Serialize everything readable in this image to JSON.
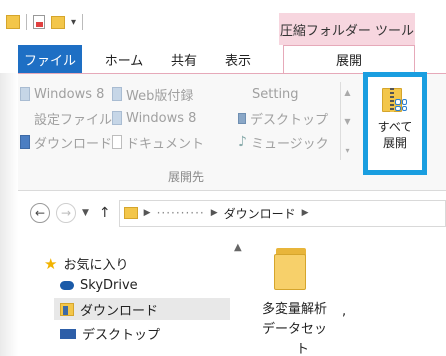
{
  "title_bar": {
    "contextual_tab_group": "圧縮フォルダー ツール"
  },
  "tabs": [
    {
      "label": "ファイル"
    },
    {
      "label": "ホーム"
    },
    {
      "label": "共有"
    },
    {
      "label": "表示"
    },
    {
      "label": "展開"
    }
  ],
  "ribbon": {
    "extract_to_items": [
      {
        "label": "Windows 8",
        "icon": "folder-icon"
      },
      {
        "label": "Web版付録",
        "icon": "folder-icon"
      },
      {
        "label": "Setting",
        "icon": "none"
      },
      {
        "label": "設定ファイル",
        "icon": "none"
      },
      {
        "label": "Windows 8",
        "icon": "folder-icon"
      },
      {
        "label": "デスクトップ",
        "icon": "desktop-icon"
      },
      {
        "label": "ダウンロード",
        "icon": "download-folder-icon"
      },
      {
        "label": "ドキュメント",
        "icon": "documents-icon"
      },
      {
        "label": "ミュージック",
        "icon": "music-icon"
      }
    ],
    "group_label": "展開先",
    "extract_all_label_line1": "すべて",
    "extract_all_label_line2": "展開"
  },
  "address_bar": {
    "hidden_segment": "··········",
    "current_folder": "ダウンロード"
  },
  "nav_pane": {
    "items": [
      {
        "label": "お気に入り",
        "icon": "star-icon"
      },
      {
        "label": "SkyDrive",
        "icon": "cloud-icon"
      },
      {
        "label": "ダウンロード",
        "icon": "download-folder-icon",
        "selected": true
      },
      {
        "label": "デスクトップ",
        "icon": "desktop-icon"
      }
    ]
  },
  "content": {
    "folder_name_line1": "多変量解析",
    "folder_name_line2": "データセッ",
    "folder_name_line3": "ト",
    "trailing_mark": ","
  },
  "colors": {
    "file_tab": "#1e6fc4",
    "contextual_group": "#f7d6df",
    "highlight_border": "#1a9ee0",
    "folder": "#f3c64a"
  }
}
